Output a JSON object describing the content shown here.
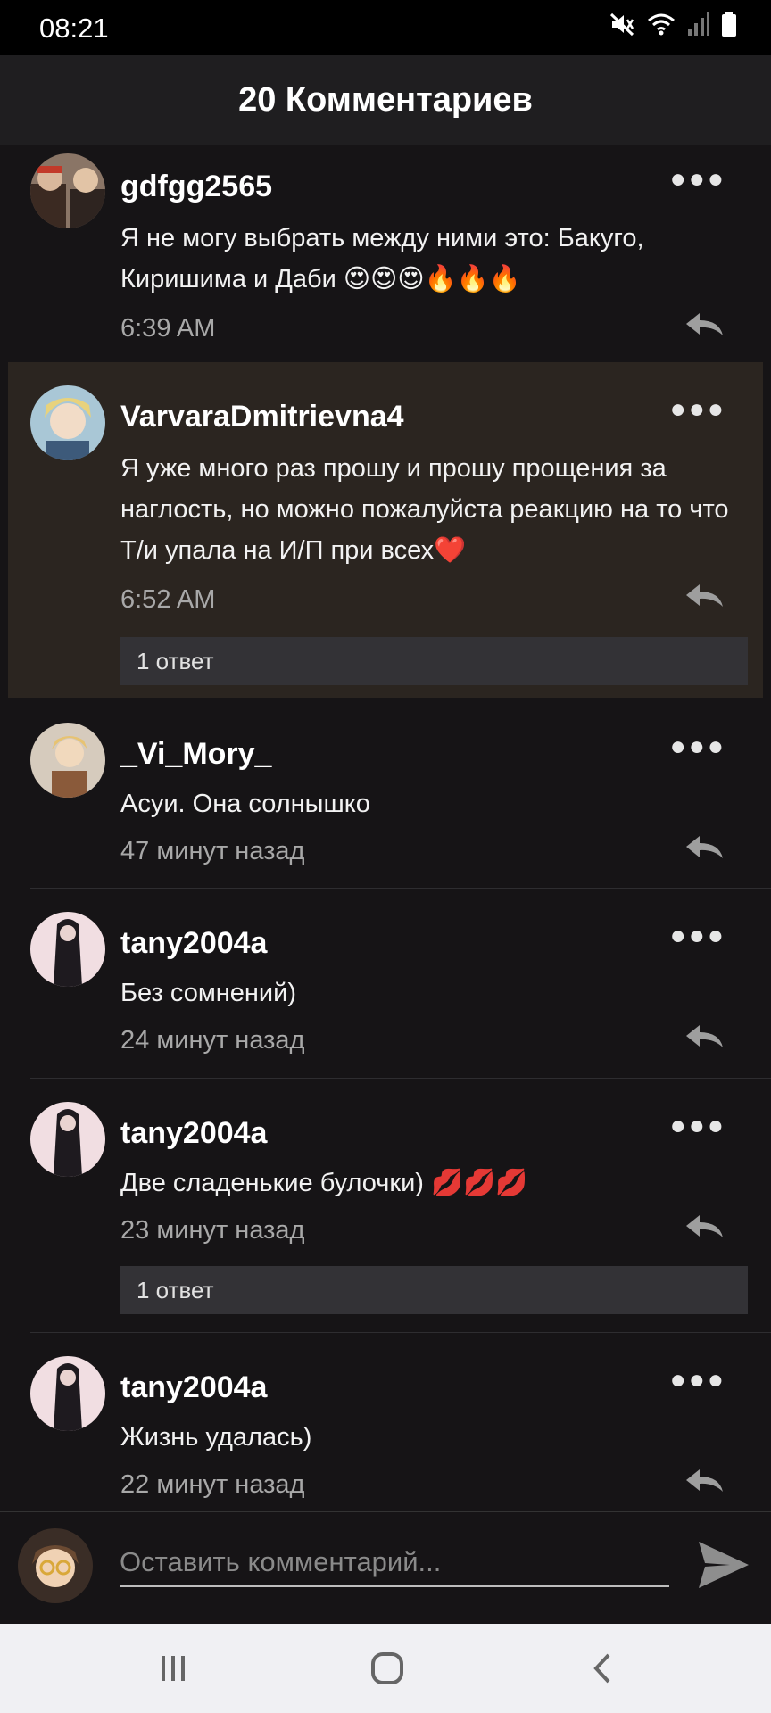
{
  "status": {
    "time": "08:21"
  },
  "header": {
    "title": "20 Комментариев"
  },
  "comments": [
    {
      "username": "gdfgg2565",
      "text": "Я не могу выбрать между ними это: Бакуго, Киришима и Даби 😍😍😍🔥🔥🔥",
      "time": "6:39 AM"
    },
    {
      "username": "VarvaraDmitrievna4",
      "text": "Я уже много раз прошу и прошу прощения за наглость, но можно пожалуйста реакцию на то что Т/и упала на И/П при всех❤️",
      "time": "6:52 AM",
      "replies": "1 ответ"
    },
    {
      "username": "_Vi_Mory_",
      "text": "Асуи. Она солнышко",
      "time": "47 минут назад"
    },
    {
      "username": "tany2004a",
      "text": "Без сомнений)",
      "time": "24 минут назад"
    },
    {
      "username": "tany2004a",
      "text": "Две сладенькие булочки) 💋💋💋",
      "time": "23 минут назад",
      "replies": "1 ответ"
    },
    {
      "username": "tany2004a",
      "text": "Жизнь удалась)",
      "time": "22 минут назад"
    }
  ],
  "compose": {
    "placeholder": "Оставить комментарий..."
  },
  "icons": {
    "more": "more-options-icon",
    "reply": "reply-icon",
    "send": "send-icon",
    "mute": "mute-icon",
    "wifi": "wifi-icon",
    "signal": "signal-icon",
    "battery": "battery-icon"
  },
  "colors": {
    "background": "#161416",
    "header": "#1f1e20",
    "highlight": "#2b2520",
    "replies_bar": "#333236",
    "secondary_text": "#a8a8a8"
  }
}
